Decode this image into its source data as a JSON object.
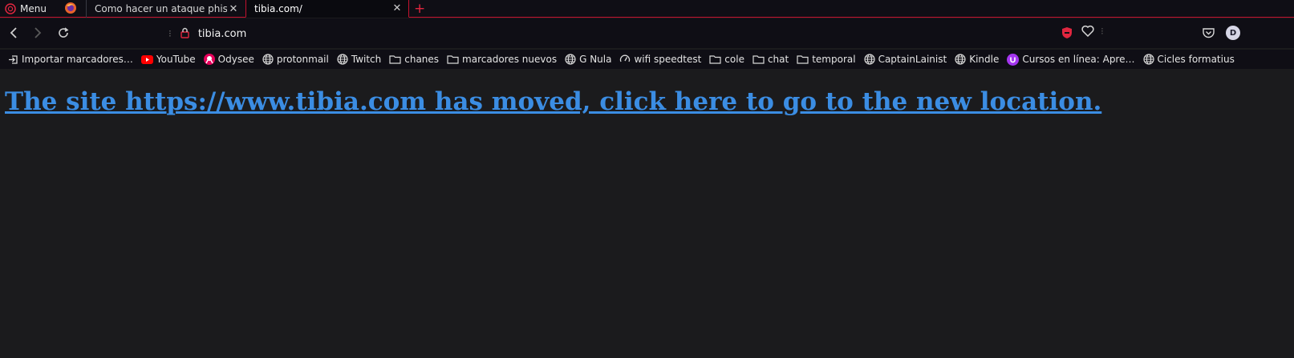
{
  "tabstrip": {
    "menu_label": "Menu",
    "tabs": [
      {
        "title": "Como hacer un ataque phishing",
        "icon": "firefox-icon"
      },
      {
        "title": "tibia.com/",
        "active": true
      }
    ],
    "new_tab": "+"
  },
  "navbar": {
    "url": "tibia.com",
    "profile_initial": "D"
  },
  "bookmarks": [
    {
      "label": "Importar marcadores…",
      "icon": "import-icon"
    },
    {
      "label": "YouTube",
      "icon": "youtube-icon"
    },
    {
      "label": "Odysee",
      "icon": "odysee-icon"
    },
    {
      "label": "protonmail",
      "icon": "globe-icon"
    },
    {
      "label": "Twitch",
      "icon": "globe-icon"
    },
    {
      "label": "chanes",
      "icon": "folder-icon"
    },
    {
      "label": "marcadores nuevos",
      "icon": "folder-icon"
    },
    {
      "label": "G Nula",
      "icon": "globe-icon"
    },
    {
      "label": "wifi speedtest",
      "icon": "speed-icon"
    },
    {
      "label": "cole",
      "icon": "folder-icon"
    },
    {
      "label": "chat",
      "icon": "folder-icon"
    },
    {
      "label": "temporal",
      "icon": "folder-icon"
    },
    {
      "label": "CaptainLainist",
      "icon": "globe-icon"
    },
    {
      "label": "Kindle",
      "icon": "globe-icon"
    },
    {
      "label": "Cursos en línea: Apre…",
      "icon": "udemy-icon"
    },
    {
      "label": "Cicles formatius",
      "icon": "globe-icon"
    }
  ],
  "page": {
    "link_text": "The site https://www.tibia.com has moved, click here to go to the new location.",
    "link_color": "#3b8de3",
    "background": "#1b1b1d"
  },
  "colors": {
    "accent": "#c4122f",
    "chrome_bg": "#0f0e15"
  }
}
